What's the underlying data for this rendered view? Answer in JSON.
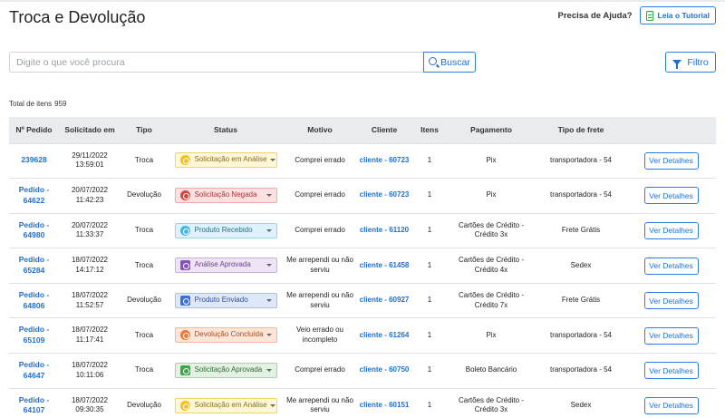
{
  "header": {
    "title": "Troca e Devolução",
    "help_label": "Precisa de Ajuda?",
    "tutorial_label": "Leia o Tutorial"
  },
  "search": {
    "placeholder": "Digite o que você procura",
    "value": "",
    "button_label": "Buscar"
  },
  "filter": {
    "button_label": "Filtro"
  },
  "summary": {
    "total_label": "Total de itens",
    "total_value": "959"
  },
  "table": {
    "columns": [
      "Nº Pedido",
      "Solicitado em",
      "Tipo",
      "Status",
      "Motivo",
      "Cliente",
      "Itens",
      "Pagamento",
      "Tipo de frete",
      ""
    ],
    "details_label": "Ver Detalhes",
    "rows": [
      {
        "pedido": "239628",
        "date": "29/11/2022",
        "time": "13:59:01",
        "tipo": "Troca",
        "status": "Solicitação em Análise",
        "status_color": "#f3c21a",
        "motivo": "Comprei errado",
        "cliente": "cliente - 60723",
        "itens": "1",
        "pagamento": "Pix",
        "frete": "transportadora - 54"
      },
      {
        "pedido": "Pedido - 64622",
        "date": "20/07/2022",
        "time": "11:42:23",
        "tipo": "Devolução",
        "status": "Solicitação Negada",
        "status_color": "#e0413a",
        "motivo": "Comprei errado",
        "cliente": "cliente - 60723",
        "itens": "1",
        "pagamento": "Pix",
        "frete": "transportadora - 54"
      },
      {
        "pedido": "Pedido - 64980",
        "date": "20/07/2022",
        "time": "11:33:37",
        "tipo": "Troca",
        "status": "Produto Recebido",
        "status_color": "#3fb8e4",
        "motivo": "Comprei errado",
        "cliente": "cliente - 61120",
        "itens": "1",
        "pagamento": "Cartões de Crédito - Crédito 3x",
        "frete": "Frete Grátis"
      },
      {
        "pedido": "Pedido - 65284",
        "date": "18/07/2022",
        "time": "14:17:12",
        "tipo": "Troca",
        "status": "Análise Aprovada",
        "status_color": "#8a4fbf",
        "motivo": "Me arrependi ou não serviu",
        "cliente": "cliente - 61458",
        "itens": "1",
        "pagamento": "Cartões de Crédito - Crédito 4x",
        "frete": "Sedex"
      },
      {
        "pedido": "Pedido - 64806",
        "date": "18/07/2022",
        "time": "11:52:57",
        "tipo": "Devolução",
        "status": "Produto Enviado",
        "status_color": "#3a6fe0",
        "motivo": "Me arrependi ou não serviu",
        "cliente": "cliente - 60927",
        "itens": "1",
        "pagamento": "Cartões de Crédito - Crédito 7x",
        "frete": "Frete Grátis"
      },
      {
        "pedido": "Pedido - 65109",
        "date": "18/07/2022",
        "time": "11:17:41",
        "tipo": "Troca",
        "status": "Devolução Concluída",
        "status_color": "#ef7a2f",
        "motivo": "Veio errado ou incompleto",
        "cliente": "cliente - 61264",
        "itens": "1",
        "pagamento": "Pix",
        "frete": "transportadora - 54"
      },
      {
        "pedido": "Pedido - 64647",
        "date": "18/07/2022",
        "time": "10:11:06",
        "tipo": "Troca",
        "status": "Solicitação Aprovada",
        "status_color": "#3aa74a",
        "motivo": "Comprei errado",
        "cliente": "cliente - 60750",
        "itens": "1",
        "pagamento": "Boleto Bancário",
        "frete": "transportadora - 54"
      },
      {
        "pedido": "Pedido - 64107",
        "date": "18/07/2022",
        "time": "09:30:35",
        "tipo": "Devolução",
        "status": "Solicitação em Análise",
        "status_color": "#f3c21a",
        "motivo": "Me arrependi ou não serviu",
        "cliente": "cliente - 60151",
        "itens": "1",
        "pagamento": "Cartões de Crédito - Crédito 3x",
        "frete": "Sedex"
      }
    ]
  }
}
